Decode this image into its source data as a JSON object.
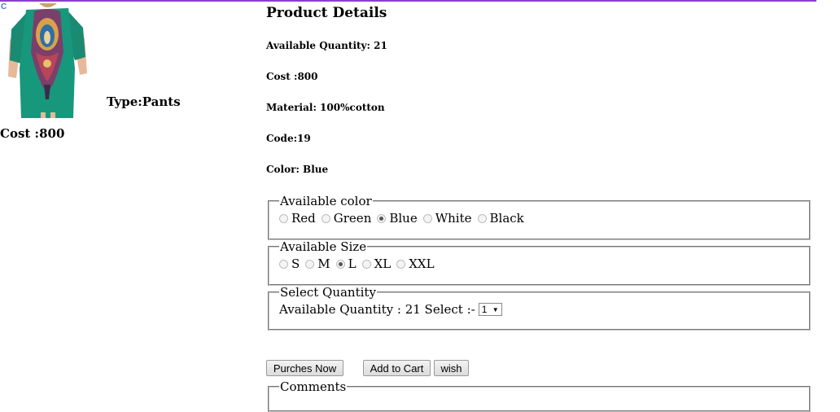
{
  "header": {
    "corner_letter": "C"
  },
  "product": {
    "type_label": "Type:Pants",
    "cost_label": "Cost :800"
  },
  "details": {
    "title": "Product Details",
    "lines": [
      "Available Quantity: 21",
      "Cost :800",
      "Material: 100%cotton",
      "Code:19",
      "Color: Blue"
    ]
  },
  "color_fieldset": {
    "legend": "Available color",
    "options": [
      "Red",
      "Green",
      "Blue",
      "White",
      "Black"
    ],
    "selected": "Blue"
  },
  "size_fieldset": {
    "legend": "Available Size",
    "options": [
      "S",
      "M",
      "L",
      "XL",
      "XXL"
    ],
    "selected": "L"
  },
  "quantity_fieldset": {
    "legend": "Select Quantity",
    "text": "Available Quantity : 21 Select :-",
    "selected_value": "1"
  },
  "buttons": {
    "purchase": "Purches Now",
    "add_to_cart": "Add to Cart",
    "wish": "wish"
  },
  "comments": {
    "legend": "Comments"
  }
}
